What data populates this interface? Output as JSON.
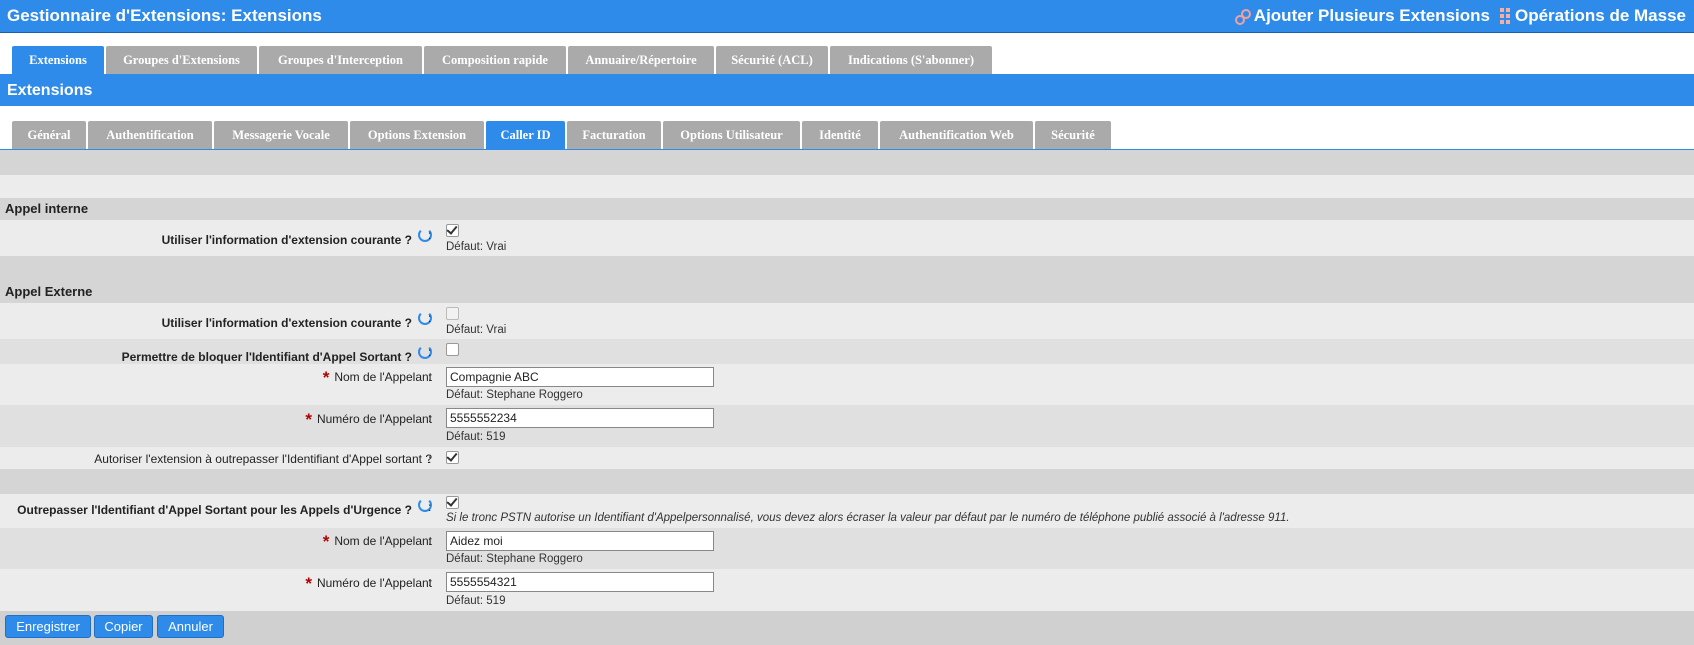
{
  "header": {
    "title": "Gestionnaire d'Extensions:  Extensions",
    "add_multiple": "Ajouter Plusieurs Extensions",
    "mass_ops": "Opérations de Masse"
  },
  "main_tabs": [
    "Extensions",
    "Groupes d'Extensions",
    "Groupes d'Interception",
    "Composition rapide",
    "Annuaire/Répertoire",
    "Sécurité (ACL)",
    "Indications (S'abonner)"
  ],
  "section_title": "Extensions",
  "sub_tabs": [
    "Général",
    "Authentification",
    "Messagerie Vocale",
    "Options Extension",
    "Caller ID",
    "Facturation",
    "Options Utilisateur",
    "Identité",
    "Authentification Web",
    "Sécurité"
  ],
  "internal": {
    "heading": "Appel interne",
    "use_current_label": "Utiliser l'information d'extension courante ?",
    "use_current_default": "Défaut: Vrai"
  },
  "external": {
    "heading": "Appel Externe",
    "use_current_label": "Utiliser l'information d'extension courante ?",
    "use_current_default": "Défaut: Vrai",
    "allow_block_label": "Permettre de bloquer l'Identifiant d'Appel Sortant ?",
    "name_label": "Nom de l'Appelant",
    "name_value": "Compagnie ABC",
    "name_default": "Défaut: Stephane Roggero",
    "number_label": "Numéro de l'Appelant",
    "number_value": "5555552234",
    "number_default": "Défaut: 519",
    "allow_override_label": "Autoriser l'extension à outrepasser l'Identifiant d'Appel sortant ?"
  },
  "emergency": {
    "override_label": "Outrepasser l'Identifiant d'Appel Sortant pour les Appels d'Urgence ?",
    "override_note": "Si le tronc PSTN autorise un Identifiant d'Appelpersonnalisé, vous devez alors écraser la valeur par défaut par le numéro de téléphone publié associé à l'adresse 911.",
    "name_label": "Nom de l'Appelant",
    "name_value": "Aidez moi",
    "name_default": "Défaut: Stephane Roggero",
    "number_label": "Numéro de l'Appelant",
    "number_value": "5555554321",
    "number_default": "Défaut: 519"
  },
  "colon": ":",
  "buttons": {
    "save": "Enregistrer",
    "copy": "Copier",
    "cancel": "Annuler"
  },
  "colors": {
    "accent": "#2e8bea",
    "required": "#b30000"
  }
}
